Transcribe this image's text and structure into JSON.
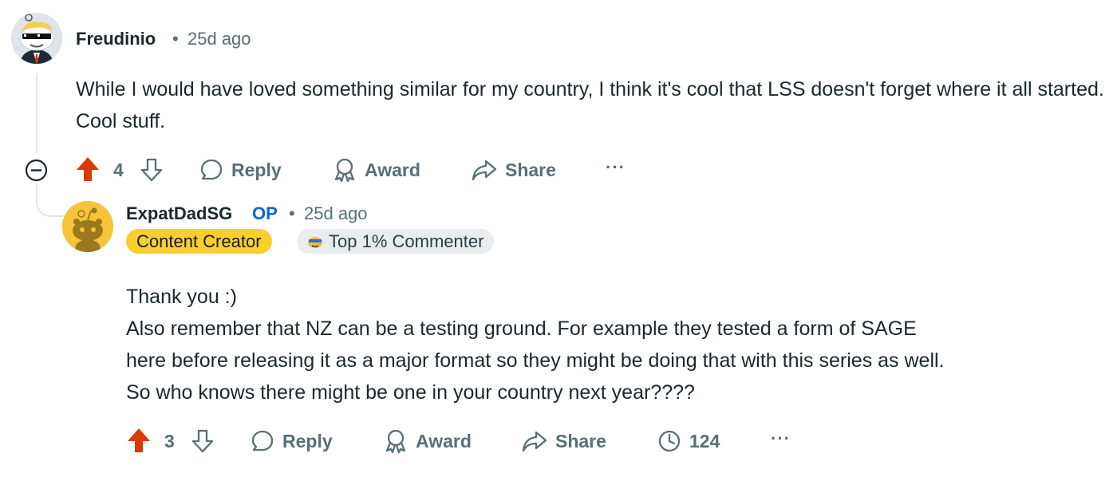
{
  "comments": [
    {
      "author": "Freudinio",
      "separator": "•",
      "time": "25d ago",
      "body": "While I would have loved something similar for my country, I think it's cool that LSS doesn't forget where it all started. Cool stuff.",
      "votes": "4",
      "actions": {
        "reply": "Reply",
        "award": "Award",
        "share": "Share",
        "more": "···"
      }
    },
    {
      "author": "ExpatDadSG",
      "op_badge": "OP",
      "separator": "•",
      "time": "25d ago",
      "flairs": [
        "Content Creator",
        "Top 1% Commenter"
      ],
      "body_lines": [
        "Thank you :)",
        "Also remember that NZ can be a testing ground. For example they tested a form of SAGE",
        "here before releasing it as a major format so they might be doing that with this series as well.",
        "So who knows there might be one in your country next year????"
      ],
      "votes": "3",
      "actions": {
        "reply": "Reply",
        "award": "Award",
        "share": "Share",
        "views": "124",
        "more": "···"
      }
    }
  ],
  "colors": {
    "upvote_active": "#d93a00",
    "meta_text": "#576f76",
    "op_blue": "#0a66d6",
    "creator_flair": "#f7d02e",
    "top_commenter_flair": "#eaedef"
  },
  "icons": [
    "collapse-icon",
    "upvote-icon",
    "downvote-icon",
    "reply-icon",
    "award-icon",
    "share-icon",
    "views-icon"
  ]
}
